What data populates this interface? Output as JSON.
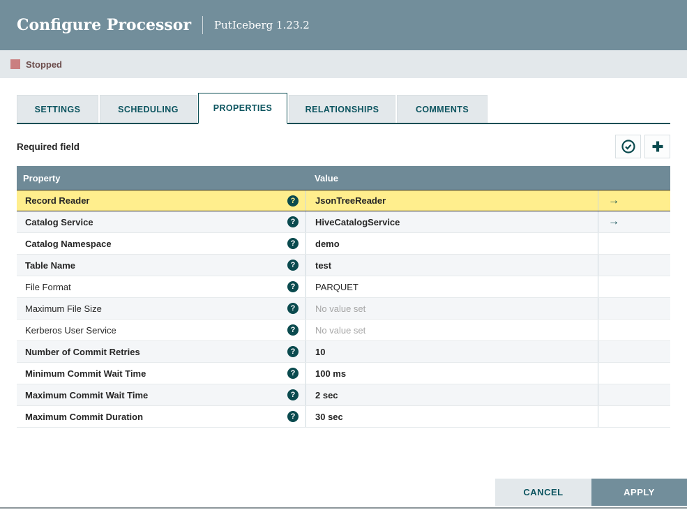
{
  "dialog": {
    "title": "Configure Processor",
    "subtitle": "PutIceberg 1.23.2",
    "status": {
      "label": "Stopped",
      "color": "#ca7f80"
    },
    "tabs": [
      {
        "label": "SETTINGS",
        "active": false
      },
      {
        "label": "SCHEDULING",
        "active": false
      },
      {
        "label": "PROPERTIES",
        "active": true
      },
      {
        "label": "RELATIONSHIPS",
        "active": false
      },
      {
        "label": "COMMENTS",
        "active": false
      }
    ],
    "toolbar": {
      "required_label": "Required field",
      "verify_icon": "check-circle-icon",
      "add_icon": "plus-icon"
    },
    "table": {
      "columns": [
        "Property",
        "Value"
      ],
      "rows": [
        {
          "property": "Record Reader",
          "value": "JsonTreeReader",
          "bold": true,
          "unset": false,
          "has_link": true,
          "highlighted": true
        },
        {
          "property": "Catalog Service",
          "value": "HiveCatalogService",
          "bold": true,
          "unset": false,
          "has_link": true,
          "highlighted": false
        },
        {
          "property": "Catalog Namespace",
          "value": "demo",
          "bold": true,
          "unset": false,
          "has_link": false,
          "highlighted": false
        },
        {
          "property": "Table Name",
          "value": "test",
          "bold": true,
          "unset": false,
          "has_link": false,
          "highlighted": false
        },
        {
          "property": "File Format",
          "value": "PARQUET",
          "bold": false,
          "unset": false,
          "has_link": false,
          "highlighted": false
        },
        {
          "property": "Maximum File Size",
          "value": "No value set",
          "bold": false,
          "unset": true,
          "has_link": false,
          "highlighted": false
        },
        {
          "property": "Kerberos User Service",
          "value": "No value set",
          "bold": false,
          "unset": true,
          "has_link": false,
          "highlighted": false
        },
        {
          "property": "Number of Commit Retries",
          "value": "10",
          "bold": true,
          "unset": false,
          "has_link": false,
          "highlighted": false
        },
        {
          "property": "Minimum Commit Wait Time",
          "value": "100 ms",
          "bold": true,
          "unset": false,
          "has_link": false,
          "highlighted": false
        },
        {
          "property": "Maximum Commit Wait Time",
          "value": "2 sec",
          "bold": true,
          "unset": false,
          "has_link": false,
          "highlighted": false
        },
        {
          "property": "Maximum Commit Duration",
          "value": "30 sec",
          "bold": true,
          "unset": false,
          "has_link": false,
          "highlighted": false
        }
      ]
    },
    "footer": {
      "cancel_label": "CANCEL",
      "apply_label": "APPLY"
    },
    "colors": {
      "header_bg": "#728e9b",
      "accent_teal": "#0d5560",
      "highlight_yellow": "#ffee8d",
      "status_stopped": "#ca7f80",
      "table_header_bg": "#6f8a97"
    }
  }
}
